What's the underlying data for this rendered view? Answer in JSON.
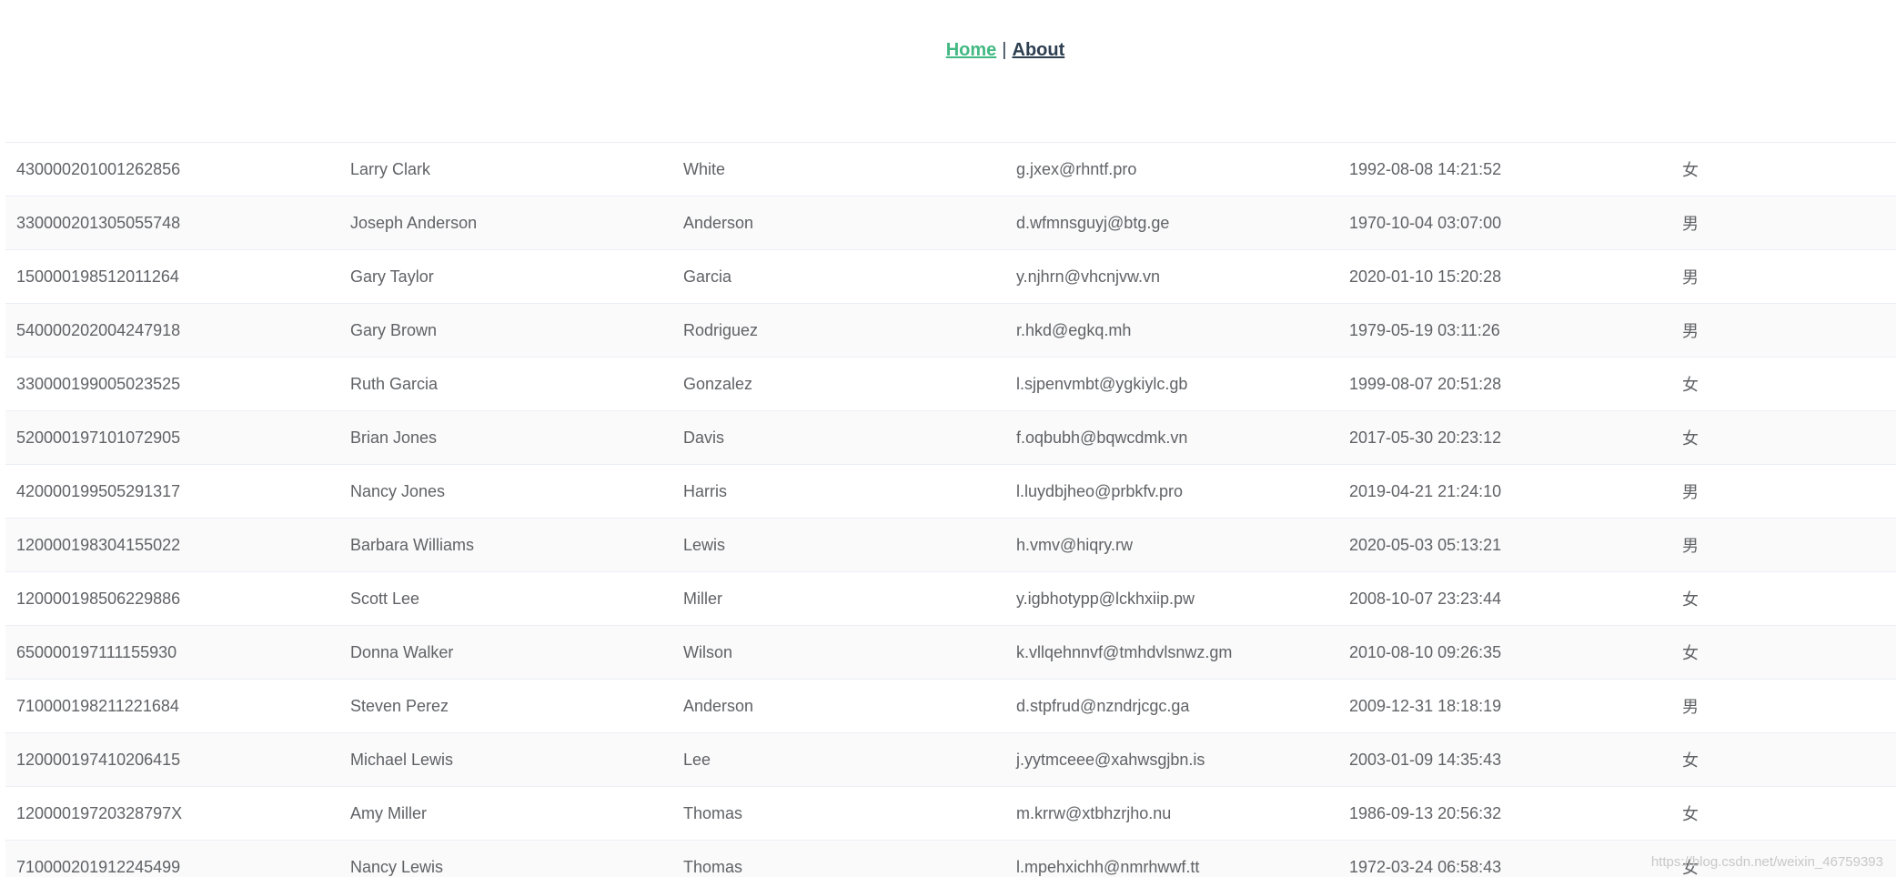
{
  "nav": {
    "home_label": "Home",
    "separator": "|",
    "about_label": "About",
    "home_color": "#42b983",
    "about_color": "#2c3e50"
  },
  "table": {
    "rows": [
      [
        "430000201001262856",
        "Larry Clark",
        "White",
        "g.jxex@rhntf.pro",
        "1992-08-08 14:21:52",
        "女"
      ],
      [
        "330000201305055748",
        "Joseph Anderson",
        "Anderson",
        "d.wfmnsguyj@btg.ge",
        "1970-10-04 03:07:00",
        "男"
      ],
      [
        "150000198512011264",
        "Gary Taylor",
        "Garcia",
        "y.njhrn@vhcnjvw.vn",
        "2020-01-10 15:20:28",
        "男"
      ],
      [
        "540000202004247918",
        "Gary Brown",
        "Rodriguez",
        "r.hkd@egkq.mh",
        "1979-05-19 03:11:26",
        "男"
      ],
      [
        "330000199005023525",
        "Ruth Garcia",
        "Gonzalez",
        "l.sjpenvmbt@ygkiylc.gb",
        "1999-08-07 20:51:28",
        "女"
      ],
      [
        "520000197101072905",
        "Brian Jones",
        "Davis",
        "f.oqbubh@bqwcdmk.vn",
        "2017-05-30 20:23:12",
        "女"
      ],
      [
        "420000199505291317",
        "Nancy Jones",
        "Harris",
        "l.luydbjheo@prbkfv.pro",
        "2019-04-21 21:24:10",
        "男"
      ],
      [
        "120000198304155022",
        "Barbara Williams",
        "Lewis",
        "h.vmv@hiqry.rw",
        "2020-05-03 05:13:21",
        "男"
      ],
      [
        "120000198506229886",
        "Scott Lee",
        "Miller",
        "y.igbhotypp@lckhxiip.pw",
        "2008-10-07 23:23:44",
        "女"
      ],
      [
        "650000197111155930",
        "Donna Walker",
        "Wilson",
        "k.vllqehnnvf@tmhdvlsnwz.gm",
        "2010-08-10 09:26:35",
        "女"
      ],
      [
        "710000198211221684",
        "Steven Perez",
        "Anderson",
        "d.stpfrud@nzndrjcgc.ga",
        "2009-12-31 18:18:19",
        "男"
      ],
      [
        "120000197410206415",
        "Michael Lewis",
        "Lee",
        "j.yytmceee@xahwsgjbn.is",
        "2003-01-09 14:35:43",
        "女"
      ],
      [
        "12000019720328797X",
        "Amy Miller",
        "Thomas",
        "m.krrw@xtbhzrjho.nu",
        "1986-09-13 20:56:32",
        "女"
      ],
      [
        "710000201912245499",
        "Nancy Lewis",
        "Thomas",
        "l.mpehxichh@nmrhwwf.tt",
        "1972-03-24 06:58:43",
        "女"
      ]
    ]
  },
  "watermark": "https://blog.csdn.net/weixin_46759393"
}
